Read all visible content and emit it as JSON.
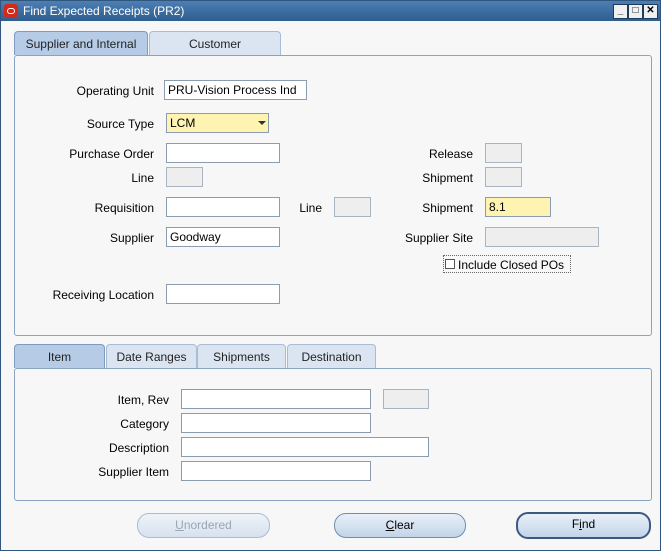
{
  "window": {
    "title": "Find Expected Receipts (PR2)",
    "minimize": "_",
    "maximize": "□",
    "close": "✕"
  },
  "top_tabs": {
    "tab1": "Supplier and Internal",
    "tab2": "Customer"
  },
  "form": {
    "operating_unit": {
      "label": "Operating Unit",
      "value": "PRU-Vision Process Ind"
    },
    "source_type": {
      "label": "Source Type",
      "value": "LCM"
    },
    "purchase_order": {
      "label": "Purchase Order",
      "value": ""
    },
    "release": {
      "label": "Release",
      "value": ""
    },
    "po_line": {
      "label": "Line",
      "value": ""
    },
    "po_shipment": {
      "label": "Shipment",
      "value": ""
    },
    "requisition": {
      "label": "Requisition",
      "value": ""
    },
    "req_line": {
      "label": "Line",
      "value": ""
    },
    "req_shipment": {
      "label": "Shipment",
      "value": "8.1"
    },
    "supplier": {
      "label": "Supplier",
      "value": "Goodway"
    },
    "supplier_site": {
      "label": "Supplier Site",
      "value": ""
    },
    "include_closed": {
      "label": "Include Closed POs",
      "checked": false
    },
    "receiving_location": {
      "label": "Receiving Location",
      "value": ""
    }
  },
  "bottom_tabs": {
    "item": "Item",
    "date_ranges": "Date Ranges",
    "shipments": "Shipments",
    "destination": "Destination"
  },
  "item_tab": {
    "item_rev": {
      "label": "Item, Rev",
      "value": "",
      "rev": ""
    },
    "category": {
      "label": "Category",
      "value": ""
    },
    "description": {
      "label": "Description",
      "value": ""
    },
    "supplier_item": {
      "label": "Supplier Item",
      "value": ""
    }
  },
  "buttons": {
    "unordered": {
      "first": "U",
      "rest": "nordered"
    },
    "clear": {
      "first": "C",
      "rest": "lear"
    },
    "find": {
      "first": "",
      "mid": "i",
      "pre": "F",
      "rest": "nd"
    }
  }
}
